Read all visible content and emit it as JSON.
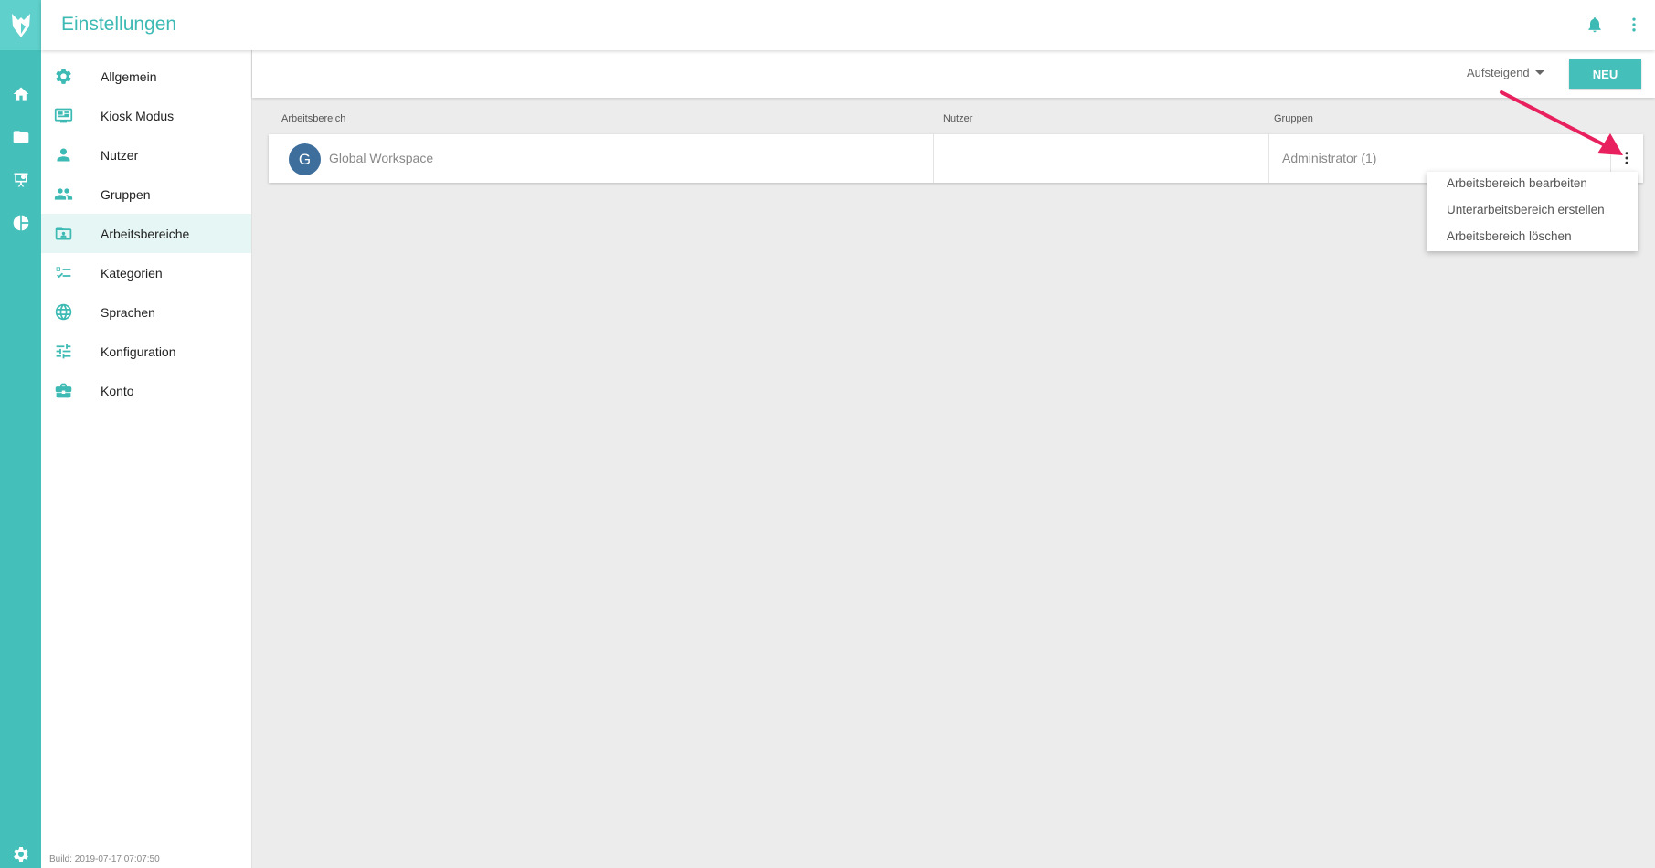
{
  "app": {
    "title": "Einstellungen"
  },
  "rail": {
    "items": [
      {
        "icon": "home-icon"
      },
      {
        "icon": "folder-icon"
      },
      {
        "icon": "presentation-icon"
      },
      {
        "icon": "pie-chart-icon"
      }
    ],
    "bottom_icon": "gear-icon"
  },
  "settings_nav": {
    "items": [
      {
        "label": "Allgemein",
        "icon": "gear-icon"
      },
      {
        "label": "Kiosk Modus",
        "icon": "monitor-icon"
      },
      {
        "label": "Nutzer",
        "icon": "person-icon"
      },
      {
        "label": "Gruppen",
        "icon": "group-icon"
      },
      {
        "label": "Arbeitsbereiche",
        "icon": "workspace-icon",
        "active": true
      },
      {
        "label": "Kategorien",
        "icon": "checklist-icon"
      },
      {
        "label": "Sprachen",
        "icon": "globe-icon"
      },
      {
        "label": "Konfiguration",
        "icon": "sliders-icon"
      },
      {
        "label": "Konto",
        "icon": "briefcase-icon"
      }
    ],
    "build": "Build: 2019-07-17 07:07:50"
  },
  "toolbar": {
    "sort_label": "Aufsteigend",
    "new_label": "NEU"
  },
  "table": {
    "headers": [
      "Arbeitsbereich",
      "Nutzer",
      "Gruppen"
    ],
    "rows": [
      {
        "avatar": "G",
        "workspace": "Global Workspace",
        "users": "",
        "groups": "Administrator (1)"
      }
    ]
  },
  "row_menu": {
    "items": [
      "Arbeitsbereich bearbeiten",
      "Unterarbeitsbereich erstellen",
      "Arbeitsbereich löschen"
    ]
  },
  "colors": {
    "accent": "#44bfba",
    "avatar": "#3e6e9b",
    "annotation": "#e8205e"
  }
}
